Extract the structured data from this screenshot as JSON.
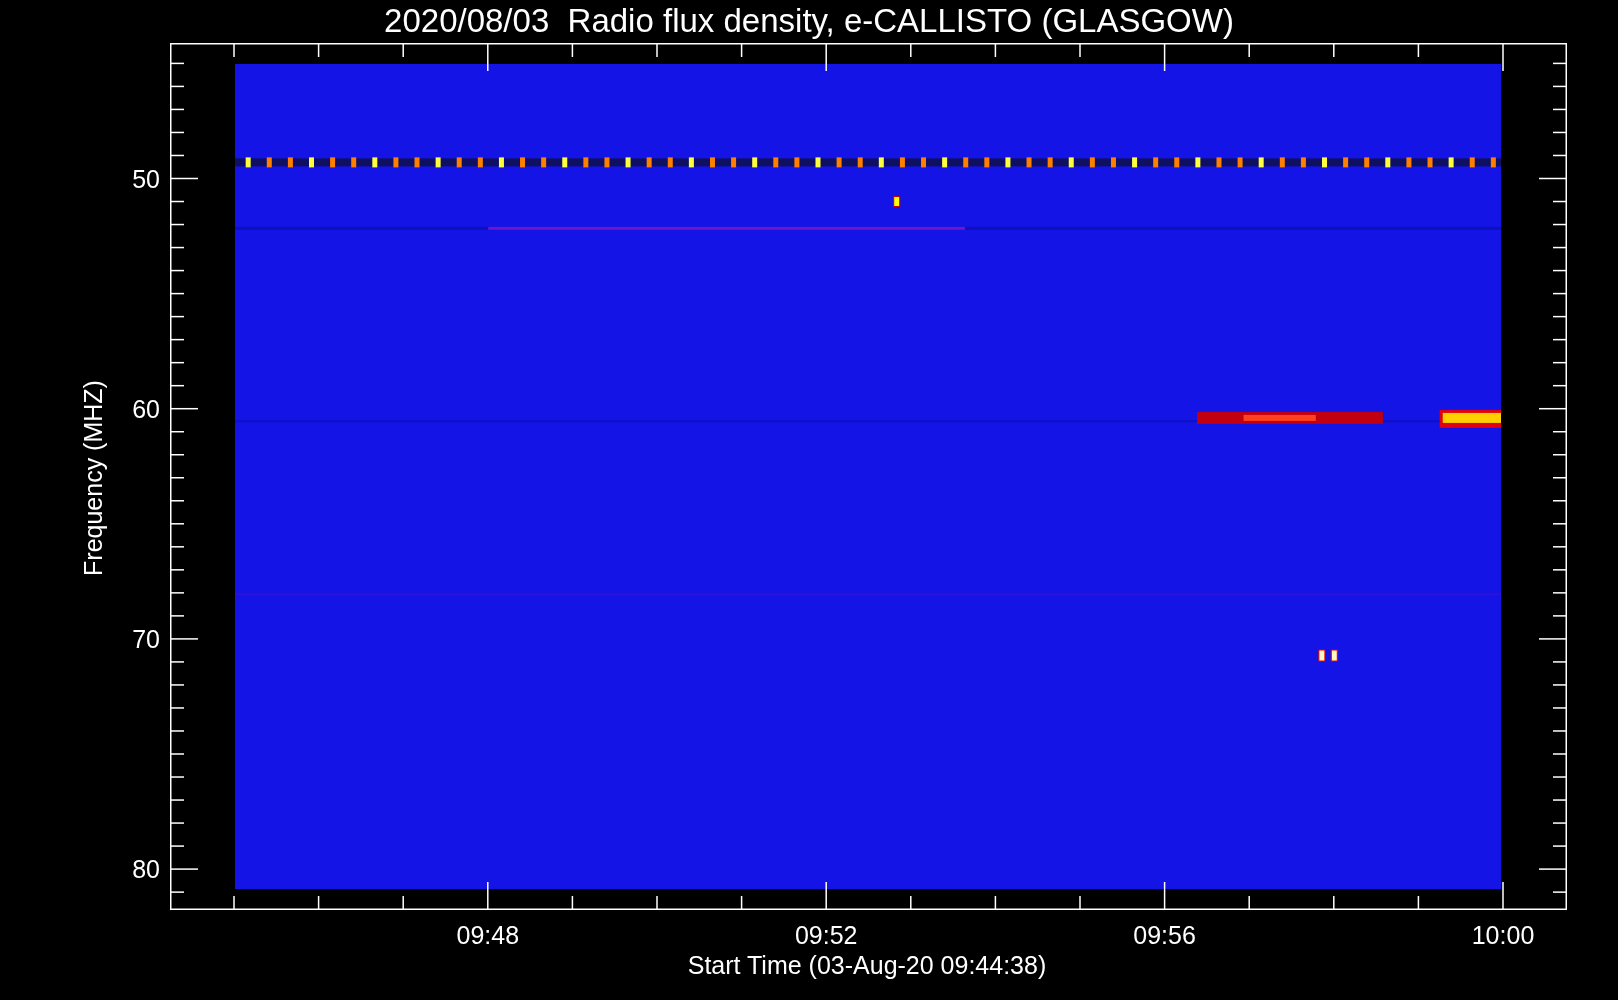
{
  "title": "2020/08/03  Radio flux density, e-CALLISTO (GLASGOW)",
  "y_axis": {
    "label": "Frequency (MHZ)",
    "ticks": [
      "50",
      "60",
      "70",
      "80"
    ]
  },
  "x_axis": {
    "label": "Start Time (03-Aug-20 09:44:38)",
    "ticks": [
      "09:48",
      "09:52",
      "09:56",
      "10:00"
    ]
  }
}
